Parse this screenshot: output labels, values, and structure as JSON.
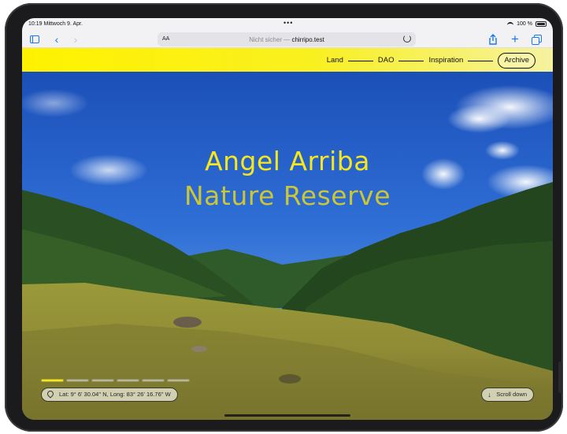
{
  "status_bar": {
    "time": "10:19",
    "date": "Mittwoch 9. Apr.",
    "battery": "100 %"
  },
  "browser": {
    "aa_label": "AA",
    "not_secure": "Nicht sicher —",
    "domain": "chirripo.test"
  },
  "site": {
    "nav": [
      "Land",
      "DAO",
      "Inspiration",
      "Archive"
    ],
    "title_line1": "Angel Arriba",
    "title_line2": "Nature Reserve",
    "coordinates": "Lat: 9° 6' 30.04'' N, Long: 83° 26' 16.76'' W",
    "scroll_label": "Scroll down",
    "slide_count": 6,
    "active_slide": 1
  },
  "colors": {
    "accent": "#f4e720",
    "link": "#1677f5"
  }
}
